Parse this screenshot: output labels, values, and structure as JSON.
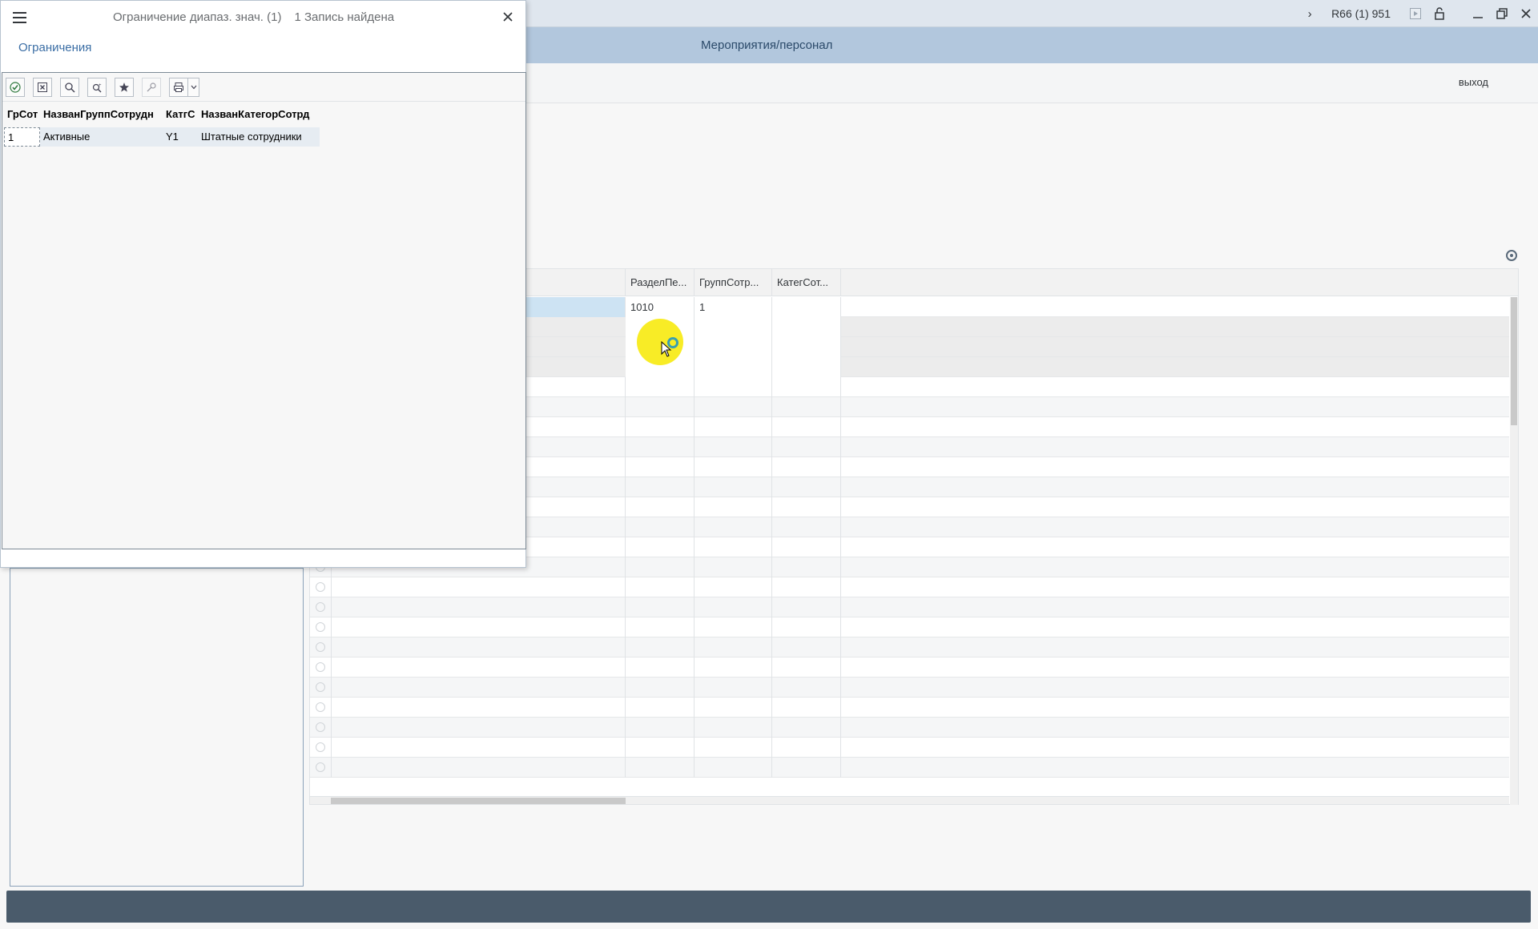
{
  "window": {
    "system_info": "R66 (1) 951",
    "header_title": "Мероприятия/персонал",
    "exit_label": "выход"
  },
  "grid": {
    "columns": [
      "РазделПе...",
      "ГруппСотр...",
      "КатегСот..."
    ],
    "rows": [
      {
        "col1": "1010",
        "col2": "1",
        "col3": ""
      }
    ]
  },
  "dialog": {
    "title": "Ограничение диапаз. знач. (1)",
    "subtitle": "1 Запись найдена",
    "tab_label": "Ограничения",
    "table": {
      "headers": [
        "ГрСот",
        "НазванГруппСотрудн",
        "КатгС",
        "НазванКатегорСотрд"
      ],
      "rows": [
        [
          "1",
          "Активные",
          "Y1",
          "Штатные сотрудники"
        ]
      ]
    },
    "toolbar_icons": [
      "checkmark-icon",
      "cancel-icon",
      "search-icon",
      "search-next-icon",
      "favorite-icon",
      "key-icon",
      "print-icon",
      "chevron-down-icon"
    ]
  },
  "icons": {
    "close": "✕",
    "chevron": "›",
    "minimize": "—",
    "restore": "❐",
    "lock": "🔓"
  }
}
